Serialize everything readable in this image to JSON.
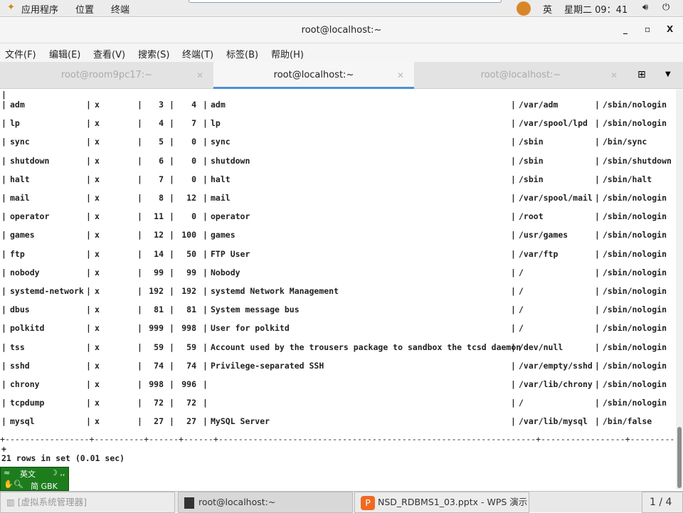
{
  "topbar": {
    "apps": "应用程序",
    "places": "位置",
    "terminal": "终端",
    "ime": "英",
    "clock": "星期二 09：41",
    "volume_icon": "volume-icon",
    "power_icon": "power-icon"
  },
  "window": {
    "title": "root@localhost:~",
    "minimize": "_",
    "maximize": "▫",
    "close": "X"
  },
  "menu": [
    "文件(F)",
    "编辑(E)",
    "查看(V)",
    "搜索(S)",
    "终端(T)",
    "标签(B)",
    "帮助(H)"
  ],
  "tabs": [
    {
      "label": "root@room9pc17:~",
      "active": false
    },
    {
      "label": "root@localhost:~",
      "active": true
    },
    {
      "label": "root@localhost:~",
      "active": false
    }
  ],
  "rows": [
    [
      "adm",
      "x",
      "3",
      "4",
      "adm",
      "/var/adm",
      "/sbin/nologin"
    ],
    [
      "lp",
      "x",
      "4",
      "7",
      "lp",
      "/var/spool/lpd",
      "/sbin/nologin"
    ],
    [
      "sync",
      "x",
      "5",
      "0",
      "sync",
      "/sbin",
      "/bin/sync"
    ],
    [
      "shutdown",
      "x",
      "6",
      "0",
      "shutdown",
      "/sbin",
      "/sbin/shutdown"
    ],
    [
      "halt",
      "x",
      "7",
      "0",
      "halt",
      "/sbin",
      "/sbin/halt"
    ],
    [
      "mail",
      "x",
      "8",
      "12",
      "mail",
      "/var/spool/mail",
      "/sbin/nologin"
    ],
    [
      "operator",
      "x",
      "11",
      "0",
      "operator",
      "/root",
      "/sbin/nologin"
    ],
    [
      "games",
      "x",
      "12",
      "100",
      "games",
      "/usr/games",
      "/sbin/nologin"
    ],
    [
      "ftp",
      "x",
      "14",
      "50",
      "FTP User",
      "/var/ftp",
      "/sbin/nologin"
    ],
    [
      "nobody",
      "x",
      "99",
      "99",
      "Nobody",
      "/",
      "/sbin/nologin"
    ],
    [
      "systemd-network",
      "x",
      "192",
      "192",
      "systemd Network Management",
      "/",
      "/sbin/nologin"
    ],
    [
      "dbus",
      "x",
      "81",
      "81",
      "System message bus",
      "/",
      "/sbin/nologin"
    ],
    [
      "polkitd",
      "x",
      "999",
      "998",
      "User for polkitd",
      "/",
      "/sbin/nologin"
    ],
    [
      "tss",
      "x",
      "59",
      "59",
      "Account used by the trousers package to sandbox the tcsd daemon",
      "/dev/null",
      "/sbin/nologin"
    ],
    [
      "sshd",
      "x",
      "74",
      "74",
      "Privilege-separated SSH",
      "/var/empty/sshd",
      "/sbin/nologin"
    ],
    [
      "chrony",
      "x",
      "998",
      "996",
      "",
      "/var/lib/chrony",
      "/sbin/nologin"
    ],
    [
      "tcpdump",
      "x",
      "72",
      "72",
      "",
      "/",
      "/sbin/nologin"
    ],
    [
      "mysql",
      "x",
      "27",
      "27",
      "MySQL Server",
      "/var/lib/mysql",
      "/bin/false"
    ]
  ],
  "separator": "+-----------------+----------+------+------+----------------------------------------------------------------+-----------------+--------------",
  "plus": "+",
  "result": "21 rows in set (0.01 sec)",
  "ime_panel": {
    "lang": "英文",
    "mode": "简 GBK"
  },
  "taskbar": {
    "items": [
      "[虚拟系统管理器]",
      "root@localhost:~",
      "NSD_RDBMS1_03.pptx - WPS 演示"
    ],
    "workspace": "1 / 4"
  }
}
